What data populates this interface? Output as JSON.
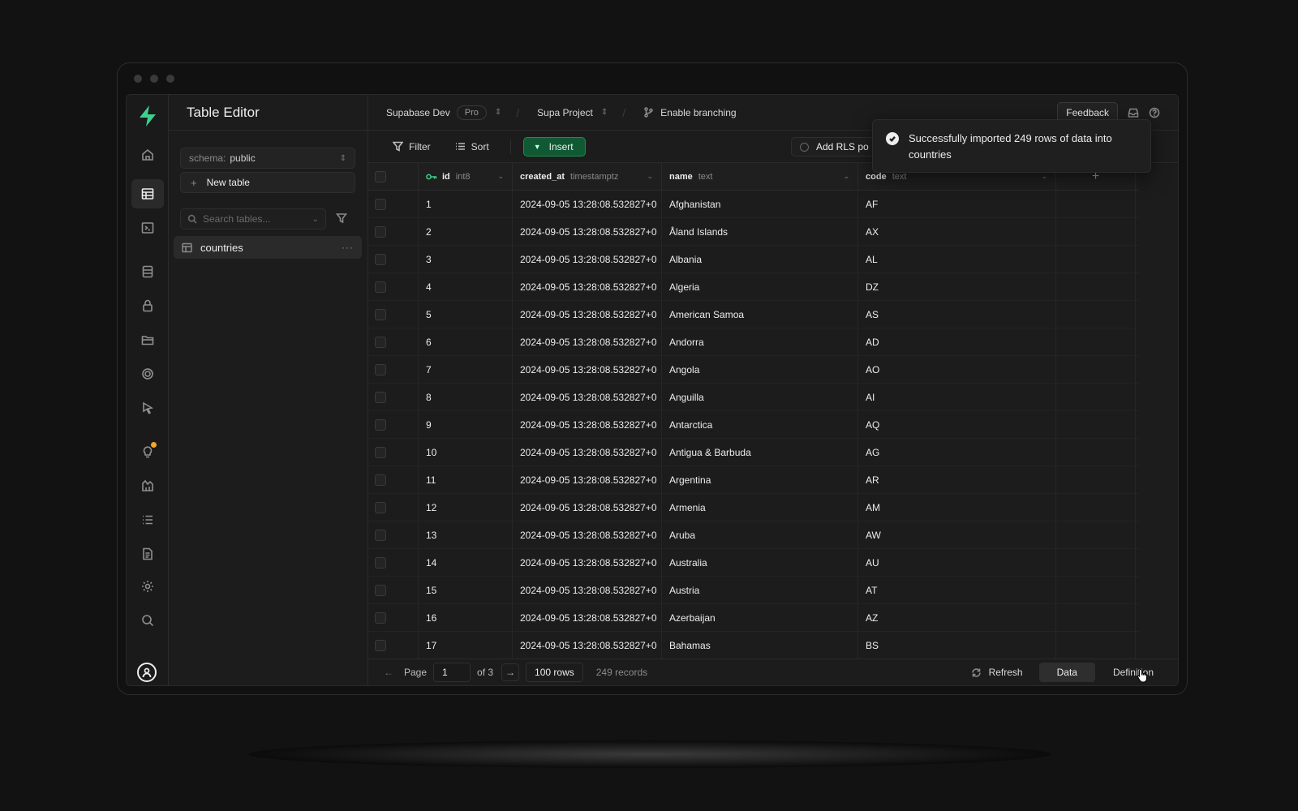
{
  "sidebar": {
    "title": "Table Editor",
    "schema_label": "schema:",
    "schema_value": "public",
    "new_table_label": "New table",
    "search_placeholder": "Search tables...",
    "tables": [
      {
        "name": "countries"
      }
    ]
  },
  "rail": {
    "icons": [
      "home-icon",
      "table-editor-icon",
      "sql-editor-icon",
      "database-icon",
      "auth-lock-icon",
      "storage-icon",
      "realtime-icon",
      "edge-functions-icon",
      "advisors-bulb-icon",
      "reports-icon",
      "logs-icon",
      "api-docs-icon",
      "settings-gear-icon",
      "search-icon"
    ],
    "active": "table-editor-icon"
  },
  "topbar": {
    "org": "Supabase Dev",
    "plan": "Pro",
    "project": "Supa Project",
    "branching_label": "Enable branching",
    "feedback_label": "Feedback"
  },
  "toolbar": {
    "filter_label": "Filter",
    "sort_label": "Sort",
    "insert_label": "Insert",
    "rls_label": "Add RLS po"
  },
  "grid": {
    "columns": [
      {
        "name": "id",
        "type": "int8",
        "primary_key": true
      },
      {
        "name": "created_at",
        "type": "timestamptz"
      },
      {
        "name": "name",
        "type": "text"
      },
      {
        "name": "code",
        "type": "text"
      }
    ],
    "rows": [
      {
        "id": "1",
        "created_at": "2024-09-05 13:28:08.532827+0",
        "name": "Afghanistan",
        "code": "AF"
      },
      {
        "id": "2",
        "created_at": "2024-09-05 13:28:08.532827+0",
        "name": "Åland Islands",
        "code": "AX"
      },
      {
        "id": "3",
        "created_at": "2024-09-05 13:28:08.532827+0",
        "name": "Albania",
        "code": "AL"
      },
      {
        "id": "4",
        "created_at": "2024-09-05 13:28:08.532827+0",
        "name": "Algeria",
        "code": "DZ"
      },
      {
        "id": "5",
        "created_at": "2024-09-05 13:28:08.532827+0",
        "name": "American Samoa",
        "code": "AS"
      },
      {
        "id": "6",
        "created_at": "2024-09-05 13:28:08.532827+0",
        "name": "Andorra",
        "code": "AD"
      },
      {
        "id": "7",
        "created_at": "2024-09-05 13:28:08.532827+0",
        "name": "Angola",
        "code": "AO"
      },
      {
        "id": "8",
        "created_at": "2024-09-05 13:28:08.532827+0",
        "name": "Anguilla",
        "code": "AI"
      },
      {
        "id": "9",
        "created_at": "2024-09-05 13:28:08.532827+0",
        "name": "Antarctica",
        "code": "AQ"
      },
      {
        "id": "10",
        "created_at": "2024-09-05 13:28:08.532827+0",
        "name": "Antigua & Barbuda",
        "code": "AG"
      },
      {
        "id": "11",
        "created_at": "2024-09-05 13:28:08.532827+0",
        "name": "Argentina",
        "code": "AR"
      },
      {
        "id": "12",
        "created_at": "2024-09-05 13:28:08.532827+0",
        "name": "Armenia",
        "code": "AM"
      },
      {
        "id": "13",
        "created_at": "2024-09-05 13:28:08.532827+0",
        "name": "Aruba",
        "code": "AW"
      },
      {
        "id": "14",
        "created_at": "2024-09-05 13:28:08.532827+0",
        "name": "Australia",
        "code": "AU"
      },
      {
        "id": "15",
        "created_at": "2024-09-05 13:28:08.532827+0",
        "name": "Austria",
        "code": "AT"
      },
      {
        "id": "16",
        "created_at": "2024-09-05 13:28:08.532827+0",
        "name": "Azerbaijan",
        "code": "AZ"
      },
      {
        "id": "17",
        "created_at": "2024-09-05 13:28:08.532827+0",
        "name": "Bahamas",
        "code": "BS"
      }
    ]
  },
  "footer": {
    "page_label": "Page",
    "page_value": "1",
    "of_label": "of 3",
    "rows_label": "100 rows",
    "records_label": "249 records",
    "refresh_label": "Refresh",
    "data_tab": "Data",
    "definition_tab": "Definition"
  },
  "toast": {
    "message": "Successfully imported 249 rows of data into countries"
  },
  "colors": {
    "brand_green": "#3ecf8e",
    "insert_bg": "#0f5a33",
    "notification_dot": "#f5a623",
    "background": "#1c1c1c"
  }
}
